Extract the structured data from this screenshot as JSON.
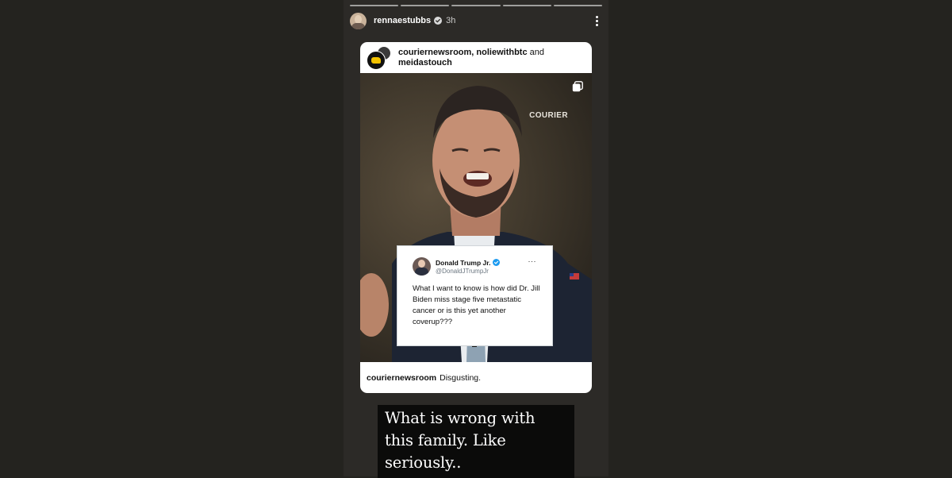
{
  "story": {
    "progress_segments": 5,
    "user": {
      "username": "rennaestubbs",
      "verified": true,
      "time": "3h",
      "avatar_icon": "profile-avatar"
    },
    "more_icon": "more-vertical-icon"
  },
  "post": {
    "collaborators_bold_1": "couriernewsroom, noliewithbtc",
    "collaborators_and": " and ",
    "collaborators_bold_2": "meidastouch",
    "media": {
      "watermark": "COURIER",
      "multi_icon": "carousel-copy-icon"
    },
    "tweet": {
      "name": "Donald Trump Jr.",
      "handle": "@DonaldJTrumpJr",
      "verified_color": "#1d9bf0",
      "more": "···",
      "body": "What I want to know is how did Dr. Jill Biden miss stage five metastatic cancer or is this yet another coverup???"
    },
    "caption": {
      "username": "couriernewsroom",
      "text": "Disgusting."
    }
  },
  "story_text": "What is wrong with this family. Like seriously..",
  "colors": {
    "page_bg": "#24231f",
    "story_bg": "#2c2a27",
    "verified_badge": "#1d9bf0"
  }
}
